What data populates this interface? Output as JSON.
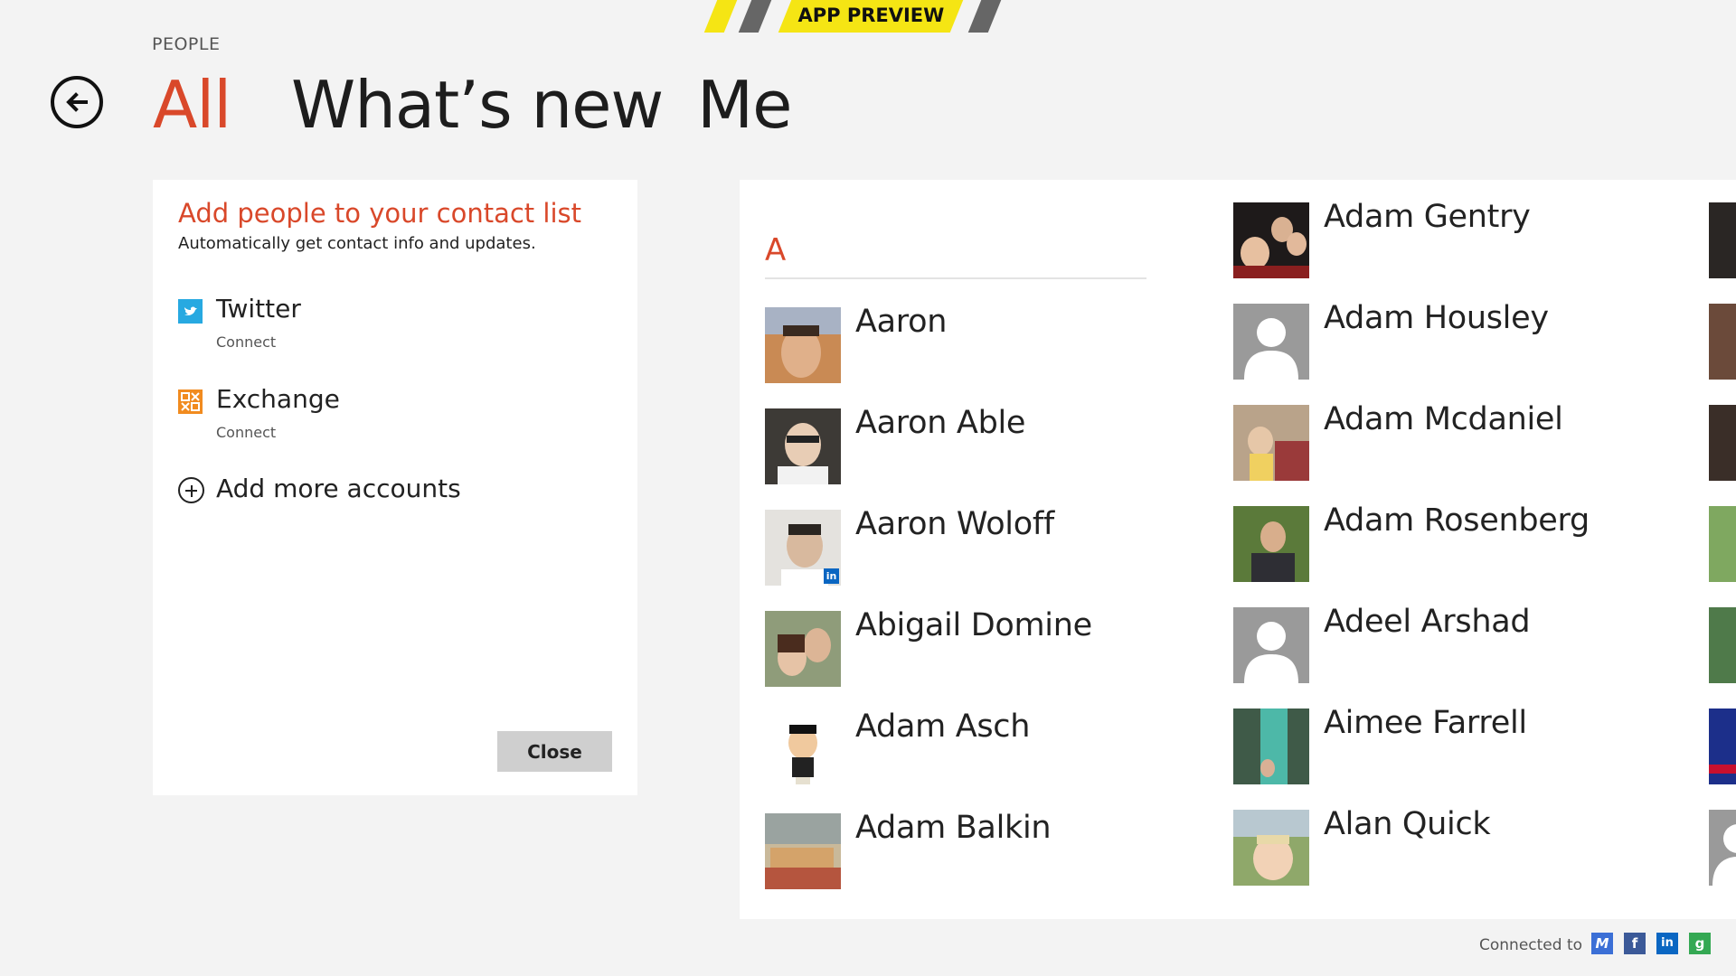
{
  "banner": {
    "label": "APP PREVIEW",
    "color": "#f5e514"
  },
  "header": {
    "app_label": "PEOPLE",
    "back_icon": "back-arrow-icon",
    "pivots": [
      {
        "label": "All",
        "active": true
      },
      {
        "label": "What’s new",
        "active": false
      },
      {
        "label": "Me",
        "active": false
      }
    ]
  },
  "accounts_panel": {
    "title": "Add people to your contact list",
    "subtitle": "Automatically get contact info and updates.",
    "accounts": [
      {
        "name": "Twitter",
        "action": "Connect",
        "icon": "twitter-icon",
        "color": "#27a9e1"
      },
      {
        "name": "Exchange",
        "action": "Connect",
        "icon": "exchange-icon",
        "color": "#f18b1f"
      }
    ],
    "add_more_label": "Add more accounts",
    "close_label": "Close"
  },
  "contacts": {
    "group_letter": "A",
    "column1": [
      {
        "name": "Aaron",
        "photo": "photo"
      },
      {
        "name": "Aaron Able",
        "photo": "photo"
      },
      {
        "name": "Aaron Woloff",
        "photo": "photo",
        "badge": "in"
      },
      {
        "name": "Abigail Domine",
        "photo": "photo"
      },
      {
        "name": "Adam Asch",
        "photo": "cartoon"
      },
      {
        "name": "Adam Balkin",
        "photo": "photo"
      }
    ],
    "column2": [
      {
        "name": "Adam Gentry",
        "photo": "photo"
      },
      {
        "name": "Adam Housley",
        "photo": "placeholder"
      },
      {
        "name": "Adam Mcdaniel",
        "photo": "photo"
      },
      {
        "name": "Adam Rosenberg",
        "photo": "photo"
      },
      {
        "name": "Adeel Arshad",
        "photo": "placeholder"
      },
      {
        "name": "Aimee Farrell",
        "photo": "photo"
      },
      {
        "name": "Alan Quick",
        "photo": "photo"
      }
    ]
  },
  "footer": {
    "connected_label": "Connected to",
    "services": [
      {
        "icon": "messenger-icon",
        "glyph": "M",
        "color": "#3b6fd6"
      },
      {
        "icon": "facebook-icon",
        "glyph": "f",
        "color": "#3b5998"
      },
      {
        "icon": "linkedin-icon",
        "glyph": "in",
        "color": "#0a66c2"
      },
      {
        "icon": "google-icon",
        "glyph": "g",
        "color": "#34a853"
      }
    ]
  },
  "colors": {
    "accent": "#d9482a",
    "background": "#f3f3f3"
  }
}
